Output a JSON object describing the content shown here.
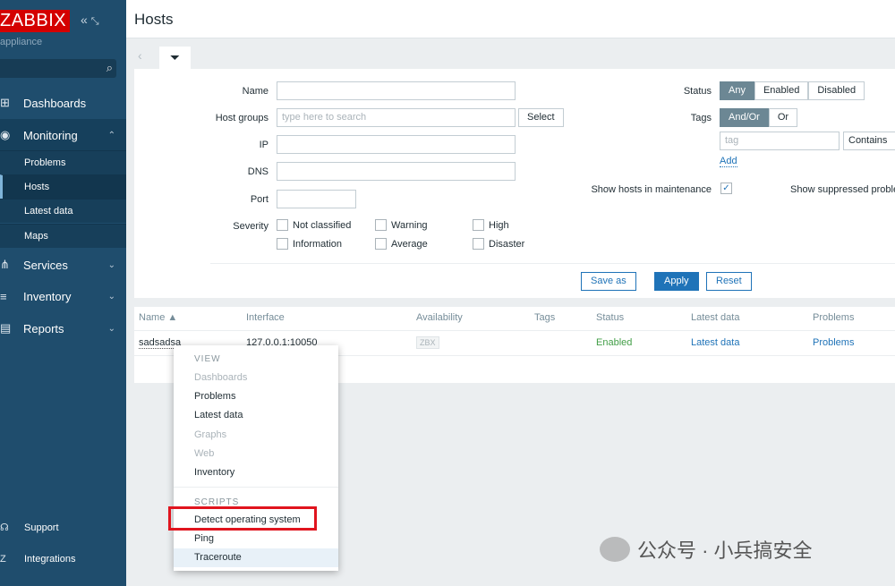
{
  "sidebar": {
    "logo": "ZABBIX",
    "subtitle": "appliance",
    "items": [
      {
        "label": "Dashboards",
        "icon": "dashboard-icon"
      },
      {
        "label": "Monitoring",
        "icon": "eye-icon",
        "expanded": true,
        "children": [
          "Problems",
          "Hosts",
          "Latest data",
          "Maps"
        ],
        "selected": "Hosts"
      },
      {
        "label": "Services",
        "icon": "services-icon"
      },
      {
        "label": "Inventory",
        "icon": "list-icon"
      },
      {
        "label": "Reports",
        "icon": "reports-icon"
      }
    ],
    "footer": [
      {
        "label": "Support",
        "icon": "headset-icon"
      },
      {
        "label": "Integrations",
        "icon": "z-icon"
      }
    ]
  },
  "header": {
    "title": "Hosts"
  },
  "filter": {
    "name_label": "Name",
    "name_value": "",
    "hostgroups_label": "Host groups",
    "hostgroups_placeholder": "type here to search",
    "select_label": "Select",
    "ip_label": "IP",
    "dns_label": "DNS",
    "port_label": "Port",
    "severity_label": "Severity",
    "severities": [
      "Not classified",
      "Warning",
      "High",
      "Information",
      "Average",
      "Disaster"
    ],
    "status_label": "Status",
    "status_options": [
      "Any",
      "Enabled",
      "Disabled"
    ],
    "status_selected": "Any",
    "tags_label": "Tags",
    "tags_options": [
      "And/Or",
      "Or"
    ],
    "tags_selected": "And/Or",
    "tag_placeholder": "tag",
    "tag_operator": "Contains",
    "add_label": "Add",
    "maintenance_label": "Show hosts in maintenance",
    "maintenance_checked": true,
    "suppressed_label": "Show suppressed proble",
    "save_as": "Save as",
    "apply": "Apply",
    "reset": "Reset"
  },
  "table": {
    "headers": [
      "Name ▲",
      "Interface",
      "Availability",
      "Tags",
      "Status",
      "Latest data",
      "Problems"
    ],
    "rows": [
      {
        "name": "sadsadsa",
        "interface": "127.0.0.1:10050",
        "availability": "ZBX",
        "status": "Enabled",
        "latest": "Latest data",
        "problems": "Problems"
      }
    ]
  },
  "context_menu": {
    "view_header": "VIEW",
    "view_items": [
      {
        "label": "Dashboards",
        "enabled": false
      },
      {
        "label": "Problems",
        "enabled": true
      },
      {
        "label": "Latest data",
        "enabled": true
      },
      {
        "label": "Graphs",
        "enabled": false
      },
      {
        "label": "Web",
        "enabled": false
      },
      {
        "label": "Inventory",
        "enabled": true
      }
    ],
    "scripts_header": "SCRIPTS",
    "scripts": [
      "Detect operating system",
      "Ping",
      "Traceroute"
    ]
  },
  "colors": {
    "sidebar": "#1f4d6d",
    "accent": "#1f73b8",
    "enabled": "#429e47",
    "highlight": "#e0141e"
  },
  "watermark": "公众号 · 小兵搞安全"
}
